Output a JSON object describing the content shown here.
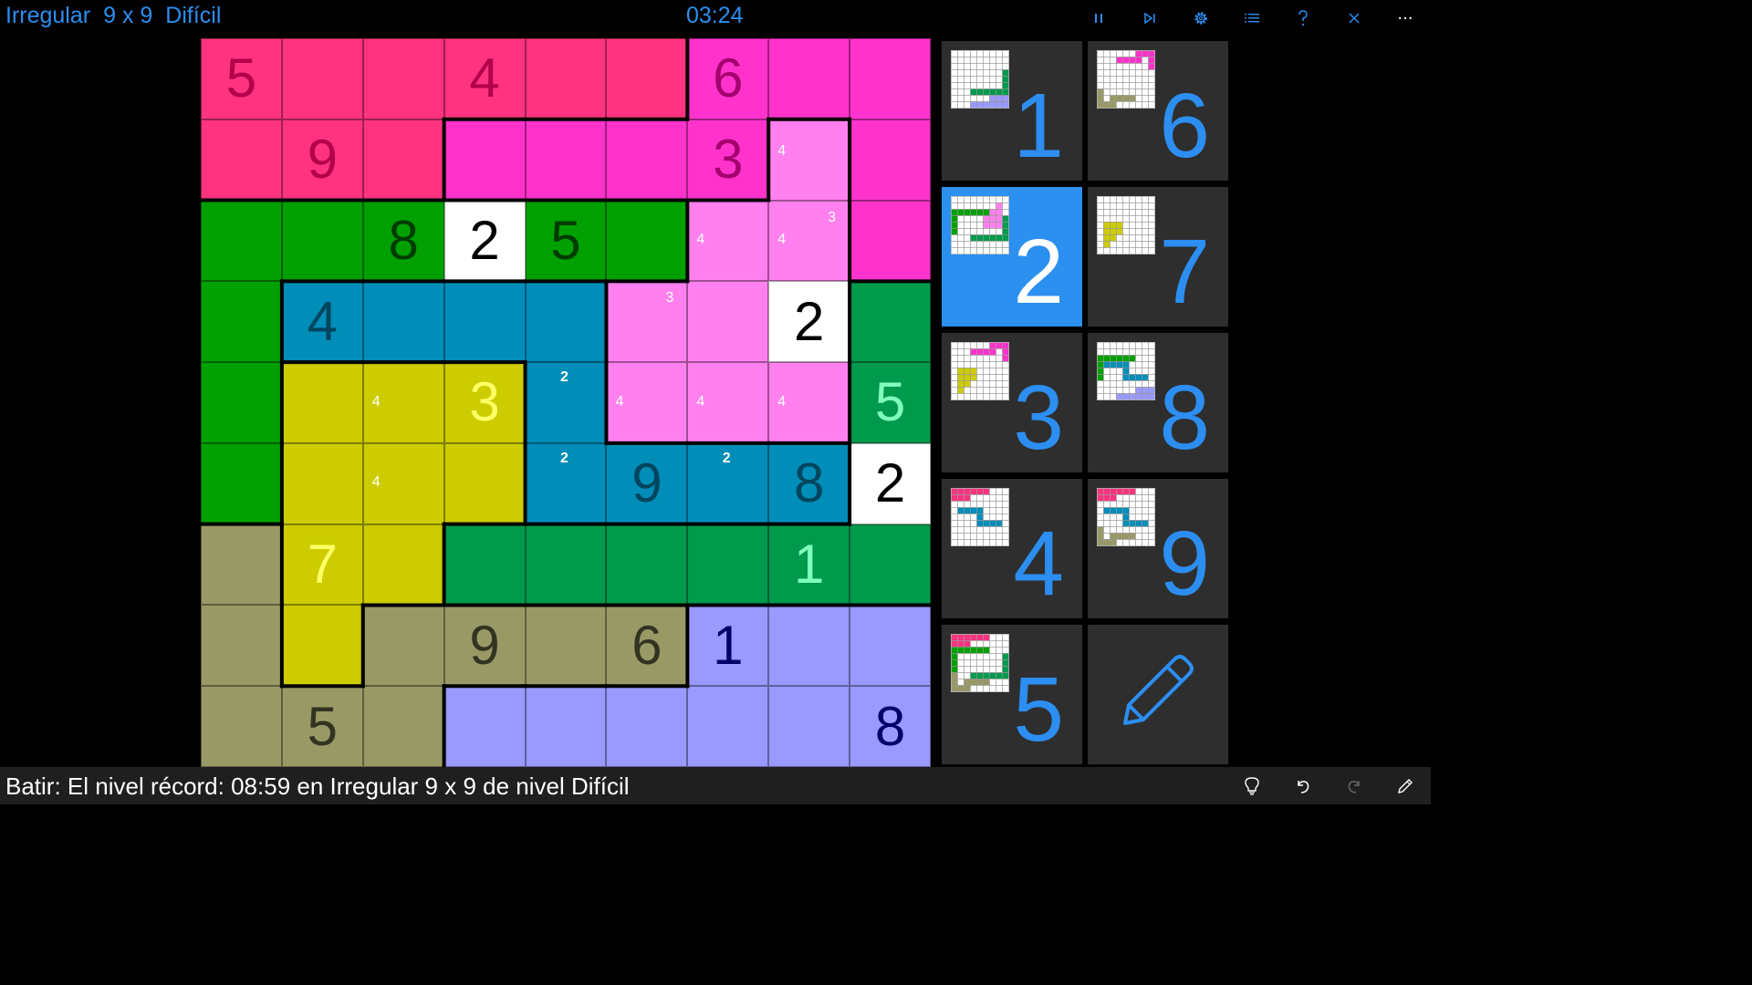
{
  "header": {
    "mode": "Irregular",
    "size": "9 x 9",
    "difficulty": "Difícil",
    "timer": "03:24",
    "icons": [
      "pause-icon",
      "skip-icon",
      "gear-icon",
      "list-icon",
      "help-icon",
      "close-icon",
      "more-icon"
    ],
    "more_label": "···"
  },
  "colors": {
    "accent": "#2c8ef0",
    "selected_key": "#2b90f0",
    "key_bg": "#2e2e2e",
    "regions": {
      "A": "#ff3380",
      "B": "#ff33cc",
      "C": "#ff80ee",
      "D": "#00a000",
      "E": "#008db8",
      "F": "#009a4c",
      "G": "#cccc00",
      "H": "#999966",
      "I": "#9999ff"
    },
    "value_colors": {
      "A": "#b3004a",
      "B": "#a3006e",
      "C": "#ffffff",
      "D": "#003c00",
      "E": "#00455e",
      "F": "#80ffbf",
      "G": "#ffff66",
      "H": "#333322",
      "I": "#00006b"
    }
  },
  "board": {
    "regions": [
      "AAAAAABBB",
      "AAABBBBCB",
      "DDDDDDCCB",
      "DEEEECCCF",
      "DGGGECCCF",
      "DGGGEEEEF",
      "HGGFFFFFF",
      "HGHHHHIII",
      "HHHIIIIII"
    ],
    "values": [
      [
        "5",
        "",
        "",
        "4",
        "",
        "",
        "6",
        "",
        ""
      ],
      [
        "",
        "9",
        "",
        "",
        "",
        "",
        "3",
        "",
        ""
      ],
      [
        "",
        "",
        "8",
        "2",
        "5",
        "",
        "",
        "",
        ""
      ],
      [
        "",
        "4",
        "",
        "",
        "",
        "",
        "",
        "2",
        ""
      ],
      [
        "",
        "",
        "",
        "3",
        "",
        "",
        "",
        "",
        "5"
      ],
      [
        "",
        "",
        "",
        "",
        "",
        "9",
        "",
        "8",
        "2"
      ],
      [
        "",
        "7",
        "",
        "",
        "",
        "",
        "",
        "1",
        ""
      ],
      [
        "",
        "",
        "",
        "9",
        "",
        "6",
        "1",
        "",
        ""
      ],
      [
        "",
        "5",
        "",
        "",
        "",
        "",
        "",
        "",
        "8"
      ]
    ],
    "highlight_value": "2",
    "highlight_cells": [
      [
        2,
        3
      ],
      [
        3,
        7
      ],
      [
        5,
        8
      ]
    ],
    "notes": [
      {
        "r": 1,
        "c": 7,
        "text": "4",
        "pos": "tl"
      },
      {
        "r": 2,
        "c": 6,
        "text": "4",
        "pos": "ml"
      },
      {
        "r": 2,
        "c": 7,
        "text": "4",
        "pos": "ml"
      },
      {
        "r": 2,
        "c": 7,
        "text": "3",
        "pos": "tr"
      },
      {
        "r": 3,
        "c": 5,
        "text": "3",
        "pos": "tr"
      },
      {
        "r": 4,
        "c": 2,
        "text": "4",
        "pos": "ml"
      },
      {
        "r": 4,
        "c": 4,
        "text": "2",
        "pos": "tc",
        "bold": true
      },
      {
        "r": 4,
        "c": 5,
        "text": "4",
        "pos": "ml"
      },
      {
        "r": 4,
        "c": 6,
        "text": "4",
        "pos": "ml"
      },
      {
        "r": 4,
        "c": 7,
        "text": "4",
        "pos": "ml"
      },
      {
        "r": 5,
        "c": 2,
        "text": "4",
        "pos": "ml"
      },
      {
        "r": 5,
        "c": 4,
        "text": "2",
        "pos": "tc",
        "bold": true
      },
      {
        "r": 5,
        "c": 6,
        "text": "2",
        "pos": "tc",
        "bold": true
      }
    ]
  },
  "keypad": {
    "selected": "2",
    "keys": [
      "1",
      "6",
      "2",
      "7",
      "3",
      "8",
      "4",
      "9",
      "5"
    ],
    "pencil_icon": "pencil-icon"
  },
  "footer": {
    "status": "Batir: El nivel récord: 08:59 en Irregular 9 x 9 de nivel Difícil",
    "icons": [
      "lightbulb-icon",
      "undo-icon",
      "redo-icon",
      "pencil-icon"
    ]
  }
}
